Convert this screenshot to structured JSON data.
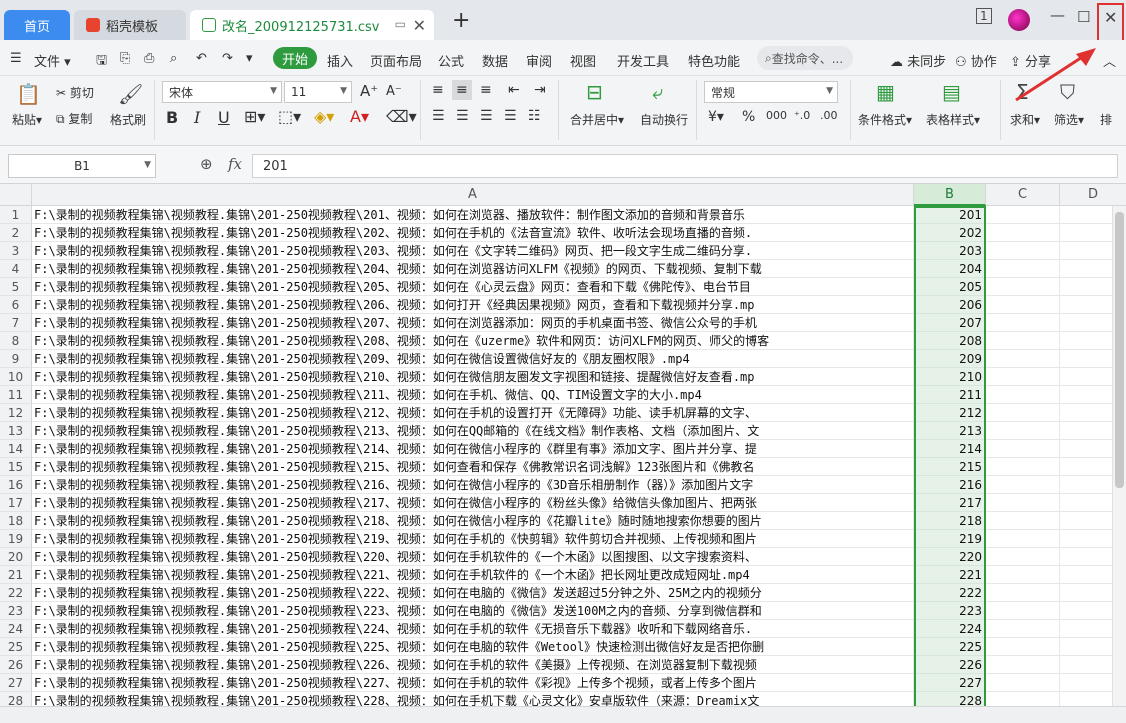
{
  "tabs": [
    {
      "label": "首页"
    },
    {
      "label": "稻壳模板"
    },
    {
      "label": "改名_200912125731.csv"
    }
  ],
  "menu": {
    "file": "文件",
    "start": "开始",
    "items": [
      "插入",
      "页面布局",
      "公式",
      "数据",
      "审阅",
      "视图",
      "开发工具",
      "特色功能"
    ],
    "search": "查找命令、...",
    "unsync": "未同步",
    "collab": "协作",
    "share": "分享"
  },
  "ribbon": {
    "paste": "粘贴",
    "cut": "剪切",
    "copy": "复制",
    "painter": "格式刷",
    "font": "宋体",
    "size": "11",
    "merge": "合并居中",
    "wrap": "自动换行",
    "numfmt": "常规",
    "cond": "条件格式",
    "tablefmt": "表格样式",
    "sum": "求和",
    "filter": "筛选",
    "sort": "排"
  },
  "formula": {
    "cell": "B1",
    "fx": "fx",
    "value": "201"
  },
  "columns": {
    "a": "A",
    "b": "B",
    "c": "C",
    "d": "D"
  },
  "rows": [
    {
      "n": "1",
      "a": "F:\\录制的视频教程集锦\\视频教程.集锦\\201-250视频教程\\201、视频：如何在浏览器、播放软件：制作图文添加的音频和背景音乐",
      "b": "201"
    },
    {
      "n": "2",
      "a": "F:\\录制的视频教程集锦\\视频教程.集锦\\201-250视频教程\\202、视频：如何在手机的《法音宣流》软件、收听法会现场直播的音频.",
      "b": "202"
    },
    {
      "n": "3",
      "a": "F:\\录制的视频教程集锦\\视频教程.集锦\\201-250视频教程\\203、视频：如何在《文字转二维码》网页、把一段文字生成二维码分享.",
      "b": "203"
    },
    {
      "n": "4",
      "a": "F:\\录制的视频教程集锦\\视频教程.集锦\\201-250视频教程\\204、视频：如何在浏览器访问XLFM《视频》的网页、下载视频、复制下载",
      "b": "204"
    },
    {
      "n": "5",
      "a": "F:\\录制的视频教程集锦\\视频教程.集锦\\201-250视频教程\\205、视频：如何在《心灵云盘》网页：查看和下载《佛陀传》、电台节目",
      "b": "205"
    },
    {
      "n": "6",
      "a": "F:\\录制的视频教程集锦\\视频教程.集锦\\201-250视频教程\\206、视频：如何打开《经典因果视频》网页，查看和下载视频并分享.mp",
      "b": "206"
    },
    {
      "n": "7",
      "a": "F:\\录制的视频教程集锦\\视频教程.集锦\\201-250视频教程\\207、视频：如何在浏览器添加：网页的手机桌面书签、微信公众号的手机",
      "b": "207"
    },
    {
      "n": "8",
      "a": "F:\\录制的视频教程集锦\\视频教程.集锦\\201-250视频教程\\208、视频：如何在《uzerme》软件和网页：访问XLFM的网页、师父的博客",
      "b": "208"
    },
    {
      "n": "9",
      "a": "F:\\录制的视频教程集锦\\视频教程.集锦\\201-250视频教程\\209、视频：如何在微信设置微信好友的《朋友圈权限》.mp4",
      "b": "209"
    },
    {
      "n": "10",
      "a": "F:\\录制的视频教程集锦\\视频教程.集锦\\201-250视频教程\\210、视频：如何在微信朋友圈发文字视图和链接、提醒微信好友查看.mp",
      "b": "210"
    },
    {
      "n": "11",
      "a": "F:\\录制的视频教程集锦\\视频教程.集锦\\201-250视频教程\\211、视频：如何在手机、微信、QQ、TIM设置文字的大小.mp4",
      "b": "211"
    },
    {
      "n": "12",
      "a": "F:\\录制的视频教程集锦\\视频教程.集锦\\201-250视频教程\\212、视频：如何在手机的设置打开《无障碍》功能、读手机屏幕的文字、",
      "b": "212"
    },
    {
      "n": "13",
      "a": "F:\\录制的视频教程集锦\\视频教程.集锦\\201-250视频教程\\213、视频：如何在QQ邮箱的《在线文档》制作表格、文档（添加图片、文",
      "b": "213"
    },
    {
      "n": "14",
      "a": "F:\\录制的视频教程集锦\\视频教程.集锦\\201-250视频教程\\214、视频：如何在微信小程序的《群里有事》添加文字、图片并分享、提",
      "b": "214"
    },
    {
      "n": "15",
      "a": "F:\\录制的视频教程集锦\\视频教程.集锦\\201-250视频教程\\215、视频：如何查看和保存《佛教常识名词浅解》123张图片和《佛教名",
      "b": "215"
    },
    {
      "n": "16",
      "a": "F:\\录制的视频教程集锦\\视频教程.集锦\\201-250视频教程\\216、视频：如何在微信小程序的《3D音乐相册制作（器）》添加图片文字",
      "b": "216"
    },
    {
      "n": "17",
      "a": "F:\\录制的视频教程集锦\\视频教程.集锦\\201-250视频教程\\217、视频：如何在微信小程序的《粉丝头像》给微信头像加图片、把两张",
      "b": "217"
    },
    {
      "n": "18",
      "a": "F:\\录制的视频教程集锦\\视频教程.集锦\\201-250视频教程\\218、视频：如何在微信小程序的《花瓣lite》随时随地搜索你想要的图片",
      "b": "218"
    },
    {
      "n": "19",
      "a": "F:\\录制的视频教程集锦\\视频教程.集锦\\201-250视频教程\\219、视频：如何在手机的《快剪辑》软件剪切合并视频、上传视频和图片",
      "b": "219"
    },
    {
      "n": "20",
      "a": "F:\\录制的视频教程集锦\\视频教程.集锦\\201-250视频教程\\220、视频：如何在手机软件的《一个木函》以图搜图、以文字搜索资料、",
      "b": "220"
    },
    {
      "n": "21",
      "a": "F:\\录制的视频教程集锦\\视频教程.集锦\\201-250视频教程\\221、视频：如何在手机软件的《一个木函》把长网址更改成短网址.mp4",
      "b": "221"
    },
    {
      "n": "22",
      "a": "F:\\录制的视频教程集锦\\视频教程.集锦\\201-250视频教程\\222、视频：如何在电脑的《微信》发送超过5分钟之外、25M之内的视频分",
      "b": "222"
    },
    {
      "n": "23",
      "a": "F:\\录制的视频教程集锦\\视频教程.集锦\\201-250视频教程\\223、视频：如何在电脑的《微信》发送100M之内的音频、分享到微信群和",
      "b": "223"
    },
    {
      "n": "24",
      "a": "F:\\录制的视频教程集锦\\视频教程.集锦\\201-250视频教程\\224、视频：如何在手机的软件《无损音乐下载器》收听和下载网络音乐.",
      "b": "224"
    },
    {
      "n": "25",
      "a": "F:\\录制的视频教程集锦\\视频教程.集锦\\201-250视频教程\\225、视频：如何在电脑的软件《Wetool》快速检测出微信好友是否把你删",
      "b": "225"
    },
    {
      "n": "26",
      "a": "F:\\录制的视频教程集锦\\视频教程.集锦\\201-250视频教程\\226、视频：如何在手机的软件《美摄》上传视频、在浏览器复制下载视频",
      "b": "226"
    },
    {
      "n": "27",
      "a": "F:\\录制的视频教程集锦\\视频教程.集锦\\201-250视频教程\\227、视频：如何在手机的软件《彩视》上传多个视频，或者上传多个图片",
      "b": "227"
    },
    {
      "n": "28",
      "a": "F:\\录制的视频教程集锦\\视频教程.集锦\\201-250视频教程\\228、视频：如何在手机下载《心灵文化》安卓版软件（来源：Dreamix文",
      "b": "228"
    }
  ],
  "colors": {
    "accent": "#2e9b3e",
    "home_tab": "#3c8cf0",
    "highlight": "#e03030"
  }
}
